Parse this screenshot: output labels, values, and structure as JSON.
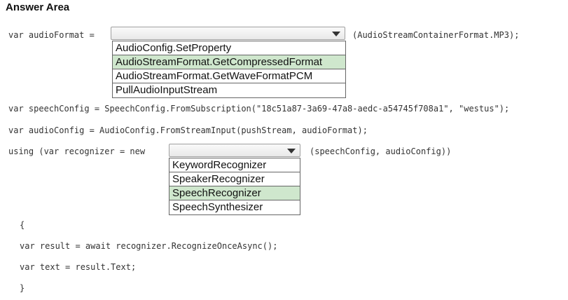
{
  "header": {
    "title": "Answer Area"
  },
  "code": {
    "line1_prefix": "var audioFormat =",
    "line1_suffix": "(AudioStreamContainerFormat.MP3);",
    "line2": "var speechConfig = SpeechConfig.FromSubscription(\"18c51a87-3a69-47a8-aedc-a54745f708a1\", \"westus\");",
    "line3": "var audioConfig = AudioConfig.FromStreamInput(pushStream, audioFormat);",
    "line4_prefix": "using (var recognizer = new",
    "line4_suffix": "(speechConfig, audioConfig))",
    "brace_open": "{",
    "line5": "var result = await recognizer.RecognizeOnceAsync();",
    "line6": "var text = result.Text;",
    "brace_close": "}"
  },
  "dropdown1": {
    "value": "",
    "options": [
      "AudioConfig.SetProperty",
      "AudioStreamFormat.GetCompressedFormat",
      "AudioStreamFormat.GetWaveFormatPCM",
      "PullAudioInputStream"
    ],
    "selected_index": 1
  },
  "dropdown2": {
    "value": "",
    "options": [
      "KeywordRecognizer",
      "SpeakerRecognizer",
      "SpeechRecognizer",
      "SpeechSynthesizer"
    ],
    "selected_index": 2
  },
  "colors": {
    "selected_option": "#cfe7cd",
    "border": "#666666"
  },
  "icons": {
    "dropdown_arrow": "chevron-down-icon"
  }
}
